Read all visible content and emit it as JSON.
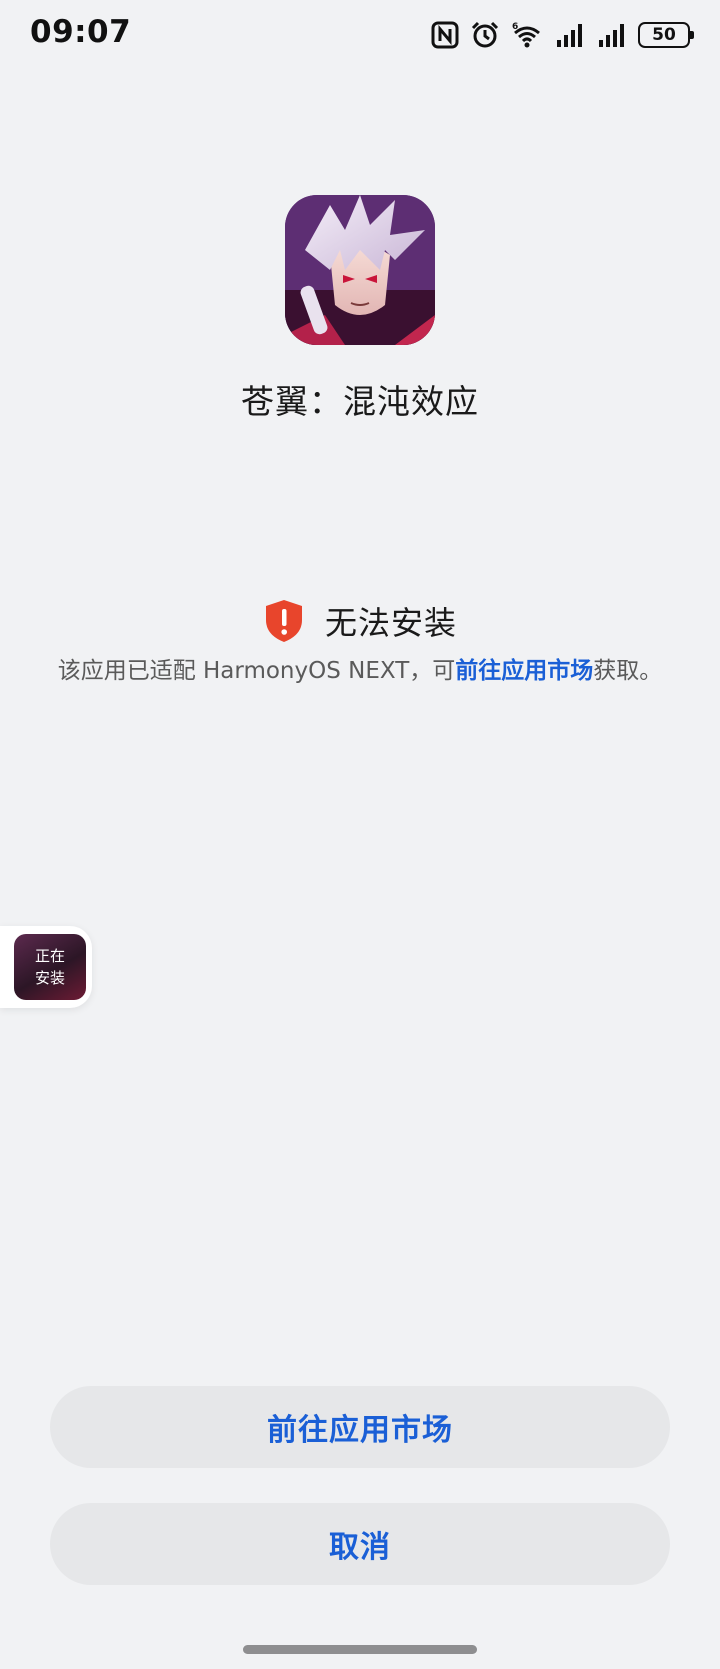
{
  "status_bar": {
    "time": "09:07",
    "icons": [
      "nfc-icon",
      "alarm-icon",
      "wifi-6-icon",
      "signal-icon",
      "signal-icon"
    ],
    "battery_level": "50"
  },
  "app": {
    "name": "苍翼：混沌效应",
    "icon": "app-icon-anime-character"
  },
  "error": {
    "title": "无法安装",
    "desc_before": "该应用已适配 HarmonyOS NEXT，可",
    "desc_link": "前往应用市场",
    "desc_after": "获取。",
    "accent_color": "#e8452c"
  },
  "float_widget": {
    "line1": "正在",
    "line2": "安装"
  },
  "buttons": {
    "market": "前往应用市场",
    "cancel": "取消"
  },
  "colors": {
    "link": "#1a5fd6",
    "background": "#f1f2f4",
    "button_bg": "#e6e7e9"
  }
}
